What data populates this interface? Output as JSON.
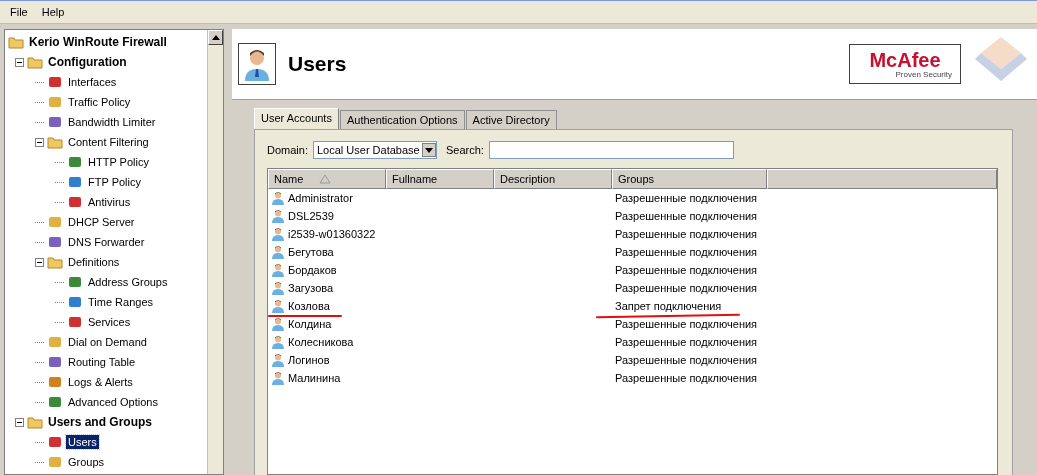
{
  "menu": [
    "File",
    "Help"
  ],
  "tree": [
    {
      "label": "Kerio WinRoute Firewall",
      "children": [
        {
          "label": "Configuration",
          "expanded": true,
          "children": [
            {
              "label": "Interfaces"
            },
            {
              "label": "Traffic Policy"
            },
            {
              "label": "Bandwidth Limiter"
            },
            {
              "label": "Content Filtering",
              "expanded": true,
              "children": [
                {
                  "label": "HTTP Policy"
                },
                {
                  "label": "FTP Policy"
                },
                {
                  "label": "Antivirus"
                }
              ]
            },
            {
              "label": "DHCP Server"
            },
            {
              "label": "DNS Forwarder"
            },
            {
              "label": "Definitions",
              "expanded": true,
              "children": [
                {
                  "label": "Address Groups"
                },
                {
                  "label": "Time Ranges"
                },
                {
                  "label": "Services"
                }
              ]
            },
            {
              "label": "Dial on Demand"
            },
            {
              "label": "Routing Table"
            },
            {
              "label": "Logs & Alerts"
            },
            {
              "label": "Advanced Options"
            }
          ]
        },
        {
          "label": "Users and Groups",
          "expanded": true,
          "children": [
            {
              "label": "Users",
              "selected": true
            },
            {
              "label": "Groups",
              "selected": false
            }
          ]
        }
      ]
    }
  ],
  "header": {
    "title": "Users",
    "logo": "McAfee",
    "logo_tagline": "Proven Security"
  },
  "tabs": [
    {
      "label": "User Accounts",
      "selected": true
    },
    {
      "label": "Authentication Options",
      "selected": false
    },
    {
      "label": "Active Directory",
      "selected": false
    }
  ],
  "domain": {
    "label": "Domain:",
    "value": "Local User Database"
  },
  "search": {
    "label": "Search:"
  },
  "table": {
    "columns": [
      {
        "label": "Name",
        "sorted": true
      },
      {
        "label": "Fullname",
        "sorted": false
      },
      {
        "label": "Description",
        "sorted": false
      },
      {
        "label": "Groups",
        "sorted": false
      }
    ],
    "rows": [
      {
        "name": "Administrator",
        "groups": "Разрешенные подключения",
        "underlined": false
      },
      {
        "name": "DSL2539",
        "groups": "Разрешенные подключения",
        "underlined": false
      },
      {
        "name": "i2539-w01360322",
        "groups": "Разрешенные подключения",
        "underlined": false
      },
      {
        "name": "Бегутова",
        "groups": "Разрешенные подключения",
        "underlined": false
      },
      {
        "name": "Бордаков",
        "groups": "Разрешенные подключения",
        "underlined": false
      },
      {
        "name": "Загузова",
        "groups": "Разрешенные подключения",
        "underlined": false
      },
      {
        "name": "Козлова",
        "groups": "Запрет подключения",
        "underlined": true
      },
      {
        "name": "Колдина",
        "groups": "Разрешенные подключения",
        "underlined": false
      },
      {
        "name": "Колесникова",
        "groups": "Разрешенные подключения",
        "underlined": false
      },
      {
        "name": "Логинов",
        "groups": "Разрешенные подключения",
        "underlined": false
      },
      {
        "name": "Малинина",
        "groups": "Разрешенные подключения",
        "underlined": false
      }
    ]
  }
}
